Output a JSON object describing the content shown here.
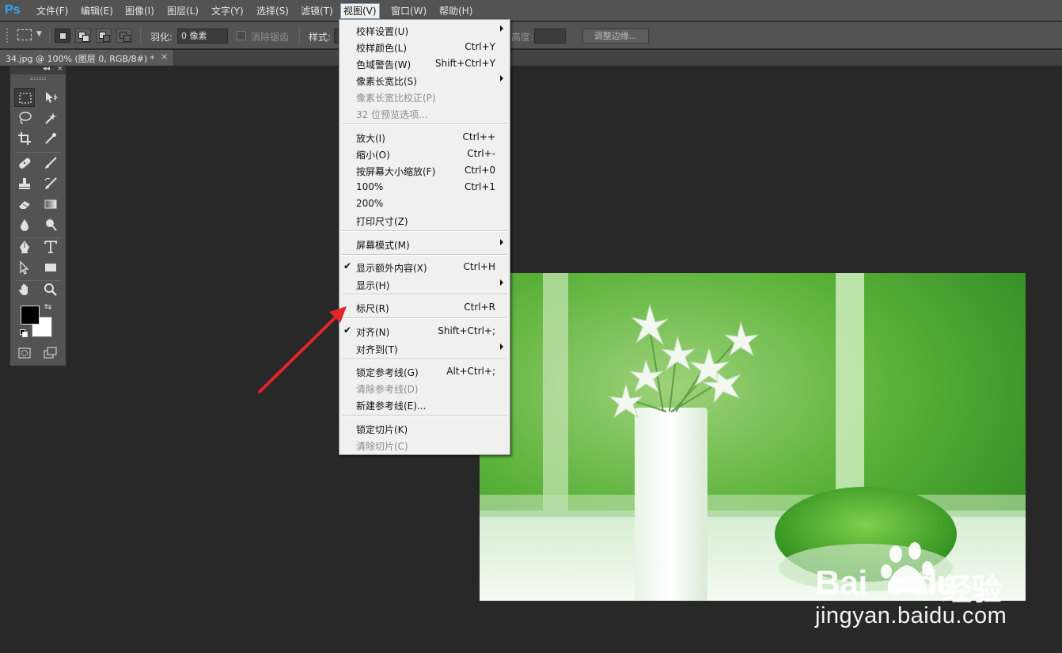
{
  "app": {
    "logo": "Ps"
  },
  "menubar": {
    "items": [
      {
        "label": "文件(F)"
      },
      {
        "label": "编辑(E)"
      },
      {
        "label": "图像(I)"
      },
      {
        "label": "图层(L)"
      },
      {
        "label": "文字(Y)"
      },
      {
        "label": "选择(S)"
      },
      {
        "label": "滤镜(T)"
      },
      {
        "label": "视图(V)"
      },
      {
        "label": "窗口(W)"
      },
      {
        "label": "帮助(H)"
      }
    ],
    "active": "视图(V)"
  },
  "options": {
    "feather_label": "羽化:",
    "feather_value": "0 像素",
    "antialias_label": "消除锯齿",
    "style_label": "样式:",
    "height_label": "高度:",
    "refine_edge_button": "调整边缘..."
  },
  "document_tab": {
    "title": "34.jpg @ 100% (图层 0, RGB/8#) *",
    "close": "×"
  },
  "toolbox": {
    "collapse": "◂◂",
    "close": "×",
    "foreground_color": "#000000",
    "background_color": "#ffffff",
    "tools": [
      "rectangular-marquee",
      "move",
      "lasso",
      "magic-wand",
      "crop",
      "eyedropper",
      "spot-healing",
      "brush",
      "clone-stamp",
      "history-brush",
      "eraser",
      "gradient",
      "blur",
      "dodge",
      "pen",
      "type",
      "path-selection",
      "rectangle",
      "hand",
      "zoom",
      "quick-mask",
      "screen-mode"
    ]
  },
  "view_menu": {
    "items": [
      {
        "label": "校样设置(U)",
        "submenu": true
      },
      {
        "label": "校样颜色(L)",
        "shortcut": "Ctrl+Y"
      },
      {
        "label": "色域警告(W)",
        "shortcut": "Shift+Ctrl+Y"
      },
      {
        "label": "像素长宽比(S)",
        "submenu": true
      },
      {
        "label": "像素长宽比校正(P)",
        "disabled": true
      },
      {
        "label": "32 位预览选项...",
        "disabled": true
      },
      {
        "label": "放大(I)",
        "shortcut": "Ctrl++"
      },
      {
        "label": "缩小(O)",
        "shortcut": "Ctrl+-"
      },
      {
        "label": "按屏幕大小缩放(F)",
        "shortcut": "Ctrl+0"
      },
      {
        "label": "100%",
        "shortcut": "Ctrl+1"
      },
      {
        "label": "200%"
      },
      {
        "label": "打印尺寸(Z)"
      },
      {
        "label": "屏幕模式(M)",
        "submenu": true
      },
      {
        "label": "显示额外内容(X)",
        "shortcut": "Ctrl+H",
        "checked": true
      },
      {
        "label": "显示(H)",
        "submenu": true
      },
      {
        "label": "标尺(R)",
        "shortcut": "Ctrl+R"
      },
      {
        "label": "对齐(N)",
        "shortcut": "Shift+Ctrl+;",
        "checked": true
      },
      {
        "label": "对齐到(T)",
        "submenu": true
      },
      {
        "label": "锁定参考线(G)",
        "shortcut": "Alt+Ctrl+;"
      },
      {
        "label": "清除参考线(D)",
        "disabled": true
      },
      {
        "label": "新建参考线(E)..."
      },
      {
        "label": "锁定切片(K)"
      },
      {
        "label": "清除切片(C)",
        "disabled": true
      }
    ],
    "check_glyph": "✔"
  },
  "watermark": {
    "brand": "Bai",
    "brand_suffix": "du",
    "jingyan": "经验",
    "url": "jingyan.baidu.com"
  },
  "annotation": {
    "arrow_color": "#e0262b",
    "points_to": "标尺(R)"
  }
}
